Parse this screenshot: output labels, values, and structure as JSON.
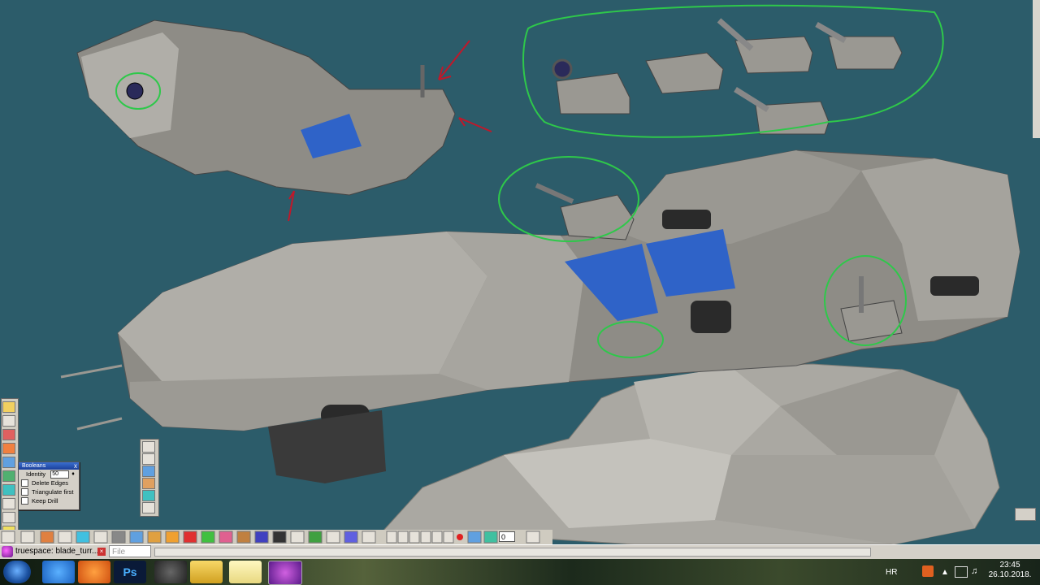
{
  "app": {
    "window_title": "truespace: blade_turr...",
    "file_menu": "File"
  },
  "booleans_panel": {
    "title": "Booleans",
    "close_label": "x",
    "identity_label": "Identity",
    "identity_value": "50",
    "options": [
      {
        "label": "Delete Edges",
        "checked": false
      },
      {
        "label": "Triangulate first",
        "checked": false
      },
      {
        "label": "Keep Drill",
        "checked": false
      }
    ]
  },
  "timeline": {
    "frame_value": "0"
  },
  "taskbar": {
    "apps": [
      "windows-start",
      "internet-explorer",
      "media-player",
      "photoshop",
      "unity",
      "file-explorer",
      "notepad",
      "truespace"
    ],
    "photoshop_label": "Ps",
    "language": "HR",
    "time": "23:45",
    "date": "26.10.2018."
  },
  "colors": {
    "viewport_bg": "#2c5c6a",
    "annotation_green": "#2ec84a",
    "annotation_red": "#c0182a",
    "hull_gray": "#8e8c86",
    "panel_blue": "#2f63c8"
  }
}
